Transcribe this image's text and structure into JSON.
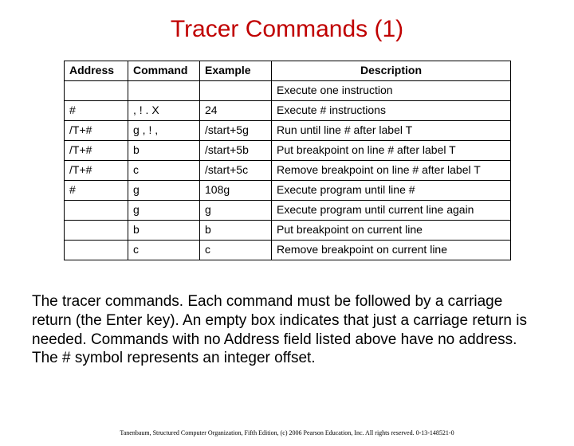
{
  "title": "Tracer Commands (1)",
  "table": {
    "headers": [
      "Address",
      "Command",
      "Example",
      "Description"
    ],
    "rows": [
      {
        "address": "",
        "command": "",
        "example": "",
        "description": "Execute one instruction"
      },
      {
        "address": "#",
        "command": ", ! . X",
        "example": "24",
        "description": "Execute # instructions"
      },
      {
        "address": "/T+#",
        "command": "g , ! ,",
        "example": "/start+5g",
        "description": "Run until line # after label T"
      },
      {
        "address": "/T+#",
        "command": "b",
        "example": "/start+5b",
        "description": "Put breakpoint on line # after label T"
      },
      {
        "address": "/T+#",
        "command": "c",
        "example": "/start+5c",
        "description": "Remove breakpoint on line # after label T"
      },
      {
        "address": "#",
        "command": "g",
        "example": "108g",
        "description": "Execute program until line #"
      },
      {
        "address": "",
        "command": "g",
        "example": "g",
        "description": "Execute program until current line again"
      },
      {
        "address": "",
        "command": "b",
        "example": "b",
        "description": "Put breakpoint on current line"
      },
      {
        "address": "",
        "command": "c",
        "example": "c",
        "description": "Remove breakpoint on current line"
      }
    ]
  },
  "caption": "The tracer commands. Each command must be followed by a carriage return (the Enter key). An empty box indicates that just a carriage return is needed. Commands with no Address field listed above have no address. The # symbol represents an integer offset.",
  "footer": "Tanenbaum, Structured Computer Organization, Fifth Edition, (c) 2006 Pearson Education, Inc. All rights reserved. 0-13-148521-0"
}
